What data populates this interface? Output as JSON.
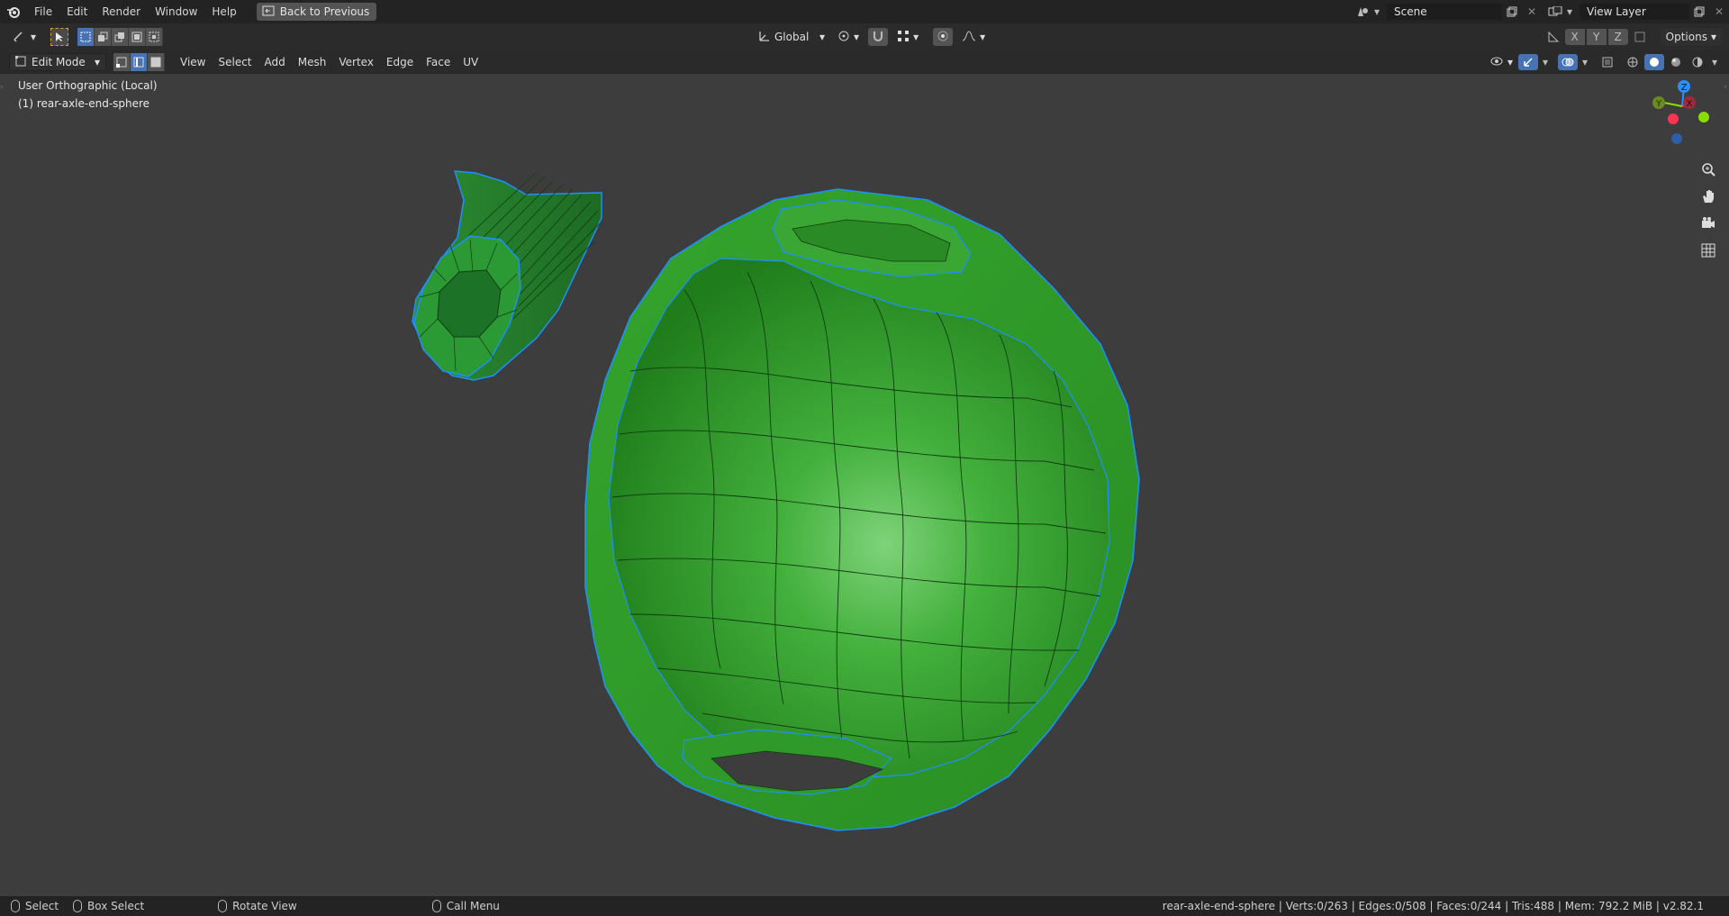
{
  "menu": {
    "items": [
      "File",
      "Edit",
      "Render",
      "Window",
      "Help"
    ],
    "back_button": "Back to Previous"
  },
  "top_right": {
    "scene": "Scene",
    "view_layer": "View Layer"
  },
  "tool_header": {
    "transform_orientation": "Global",
    "axes": [
      "X",
      "Y",
      "Z"
    ],
    "options": "Options"
  },
  "viewport_header": {
    "mode": "Edit Mode",
    "menus": [
      "View",
      "Select",
      "Add",
      "Mesh",
      "Vertex",
      "Edge",
      "Face",
      "UV"
    ]
  },
  "viewport": {
    "view_name": "User Orthographic (Local)",
    "object_name": "(1) rear-axle-end-sphere"
  },
  "gizmo": {
    "labels": [
      "Z",
      "Y",
      "X"
    ],
    "colors": {
      "x": "#ff3352",
      "y": "#8bdc00",
      "z": "#2890ff"
    }
  },
  "statusbar": {
    "select": "Select",
    "box_select": "Box Select",
    "rotate_view": "Rotate View",
    "call_menu": "Call Menu",
    "stats": "rear-axle-end-sphere | Verts:0/263 | Edges:0/508 | Faces:0/244 | Tris:488 | Mem: 792.2 MiB | v2.82.1"
  },
  "colors": {
    "mesh_green": "#33a22f",
    "selection_blue": "#1e90ff",
    "viewport_bg": "#3d3d3d"
  }
}
